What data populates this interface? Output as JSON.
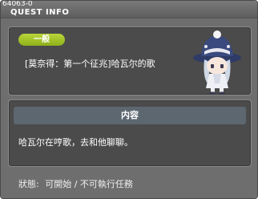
{
  "window": {
    "quest_id": "64063-0",
    "title": "QUEST INFO"
  },
  "quest": {
    "badge": "一般",
    "name": "[莫奈得：第一个征兆]哈瓦尔的歌",
    "npc_icon": "npc-girl-white-hat-sprite"
  },
  "content": {
    "header": "内容",
    "text": "哈瓦尔在哼歌，去和他聊聊。"
  },
  "status": {
    "label": "狀態:",
    "value": "可開始 / 不可執行任務"
  },
  "colors": {
    "window_bg": "#6e6e6e",
    "panel_bg": "#4b4b4b",
    "badge_green": "#9bc02a",
    "header_bar": "#5d6770"
  }
}
